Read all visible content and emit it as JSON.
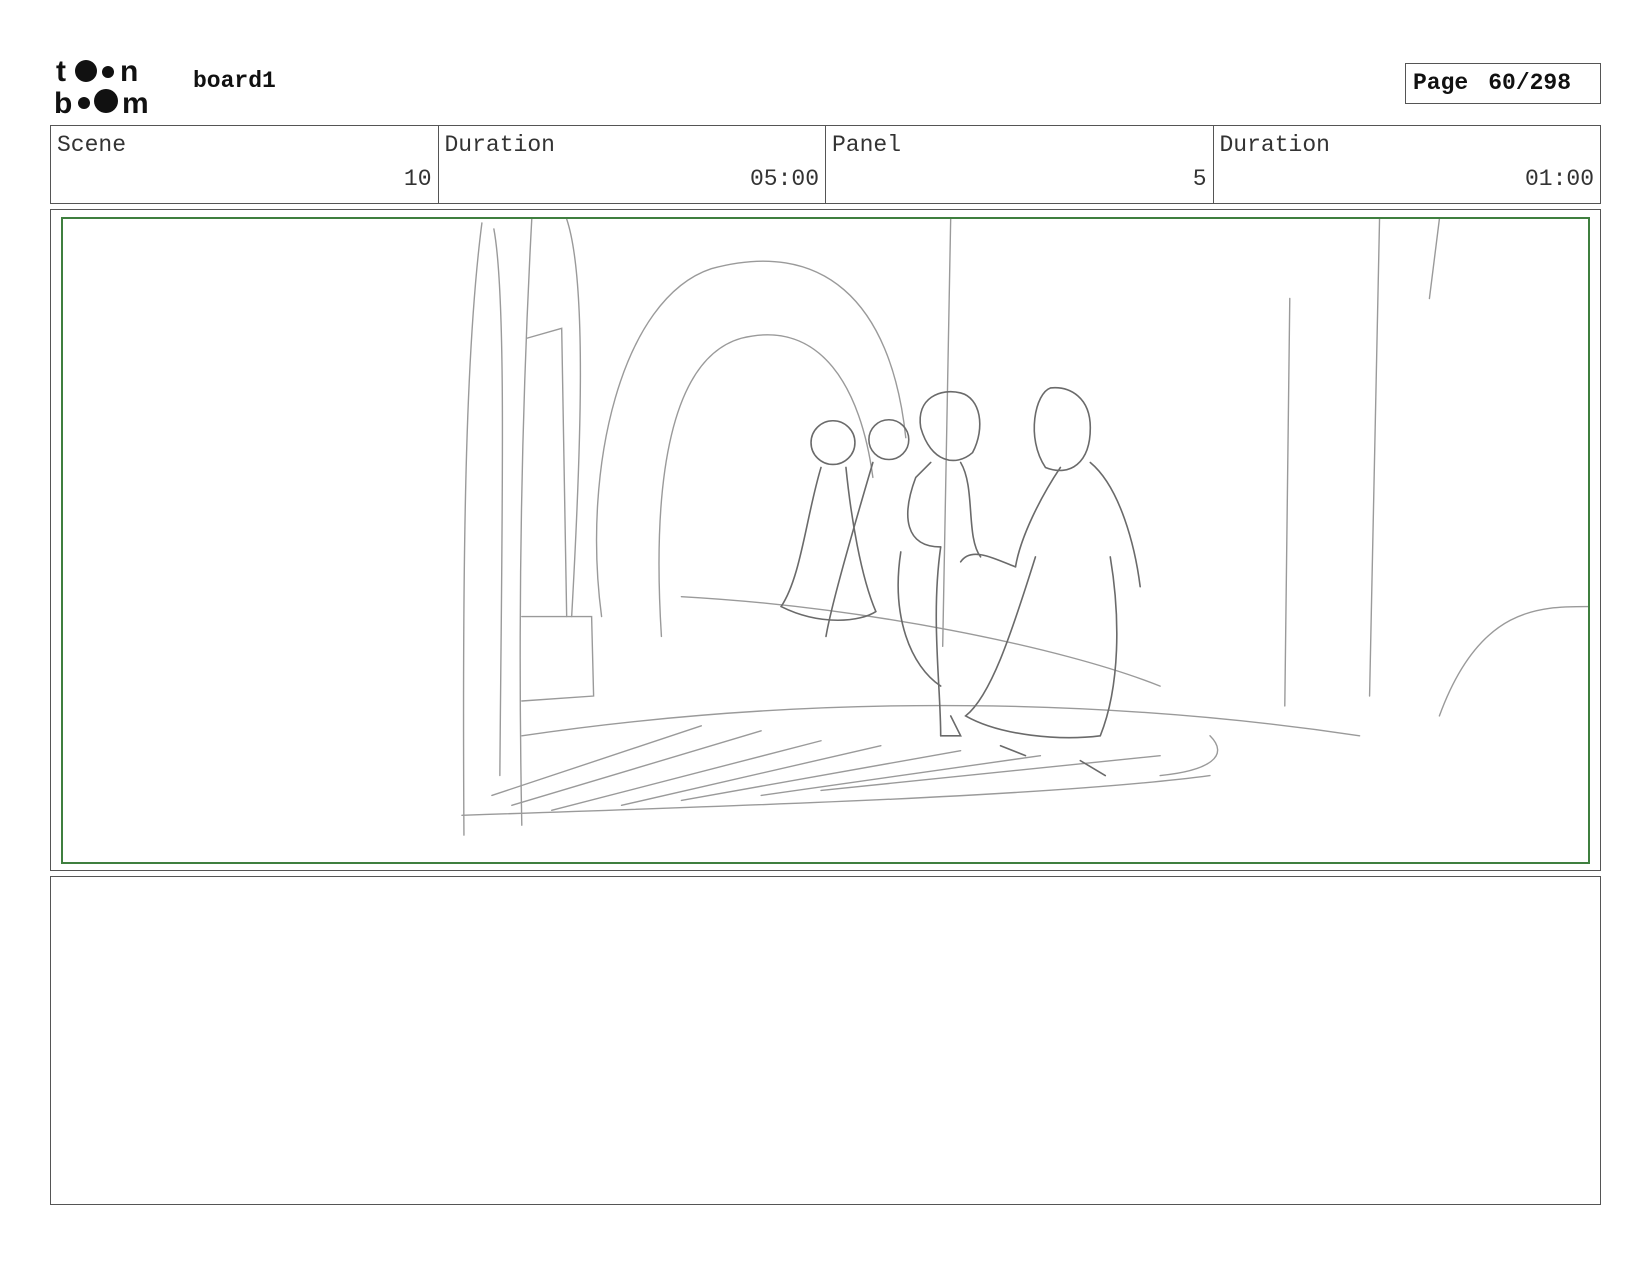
{
  "header": {
    "logo_icon": "toonboom-logo-icon",
    "board_name": "board1",
    "page_label": "Page",
    "page_number": "60/298"
  },
  "info": {
    "scene_label": "Scene",
    "scene_value": "10",
    "scene_duration_label": "Duration",
    "scene_duration_value": "05:00",
    "panel_label": "Panel",
    "panel_value": "5",
    "panel_duration_label": "Duration",
    "panel_duration_value": "01:00"
  },
  "colors": {
    "safe_area_border": "#3f7f3f",
    "sketch_line": "#8a8a8a"
  },
  "notes": {
    "text": ""
  }
}
